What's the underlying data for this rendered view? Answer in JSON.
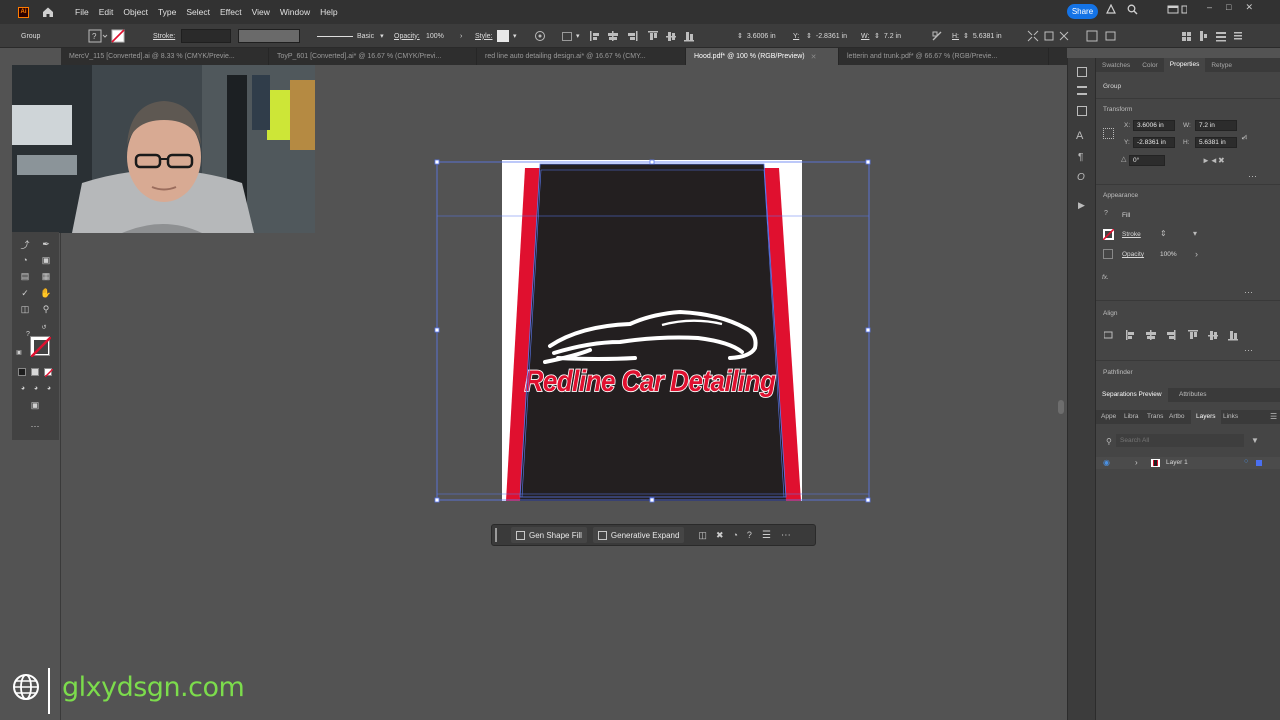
{
  "menubar": {
    "app_icon": "Ai",
    "items": [
      "File",
      "Edit",
      "Object",
      "Type",
      "Select",
      "Effect",
      "View",
      "Window",
      "Help"
    ],
    "share_label": "Share"
  },
  "controlbar": {
    "selection_type": "Group",
    "stroke_label": "Stroke:",
    "brush_label": "Basic",
    "opacity_label": "Opacity:",
    "opacity_value": "100%",
    "style_label": "Style:",
    "x_label": "X:",
    "x_value": "3.6006 in",
    "y_label": "Y:",
    "y_value": "-2.8361 in",
    "w_label": "W:",
    "w_value": "7.2 in",
    "h_label": "H:",
    "h_value": "5.6381 in"
  },
  "tabs": [
    {
      "label": "MercV_115 [Converted].ai @ 8.33 % (CMYK/Previe...",
      "active": false
    },
    {
      "label": "ToyP_601 [Converted].ai* @ 16.67 % (CMYK/Previ...",
      "active": false
    },
    {
      "label": "red line auto detailing design.ai* @ 16.67 % (CMY...",
      "active": false
    },
    {
      "label": "Hood.pdf* @ 100 % (RGB/Preview)",
      "active": true
    },
    {
      "label": "letterin and trunk.pdf* @ 66.67 % (RGB/Previe...",
      "active": false
    }
  ],
  "artwork": {
    "brand_text": "Redline Car Detailing",
    "colors": {
      "panel": "#231f20",
      "stripe": "#e0102f",
      "paper": "#ffffff",
      "selection": "#5a78f0"
    }
  },
  "context_bar": {
    "gen_shape_fill": "Gen Shape Fill",
    "generative_expand": "Generative Expand"
  },
  "right_panel": {
    "tabs": [
      "Swatches",
      "Color",
      "Properties",
      "Retype"
    ],
    "active_tab": "Properties",
    "selection_type": "Group",
    "transform_label": "Transform",
    "x_label": "X:",
    "x_value": "3.6006 in",
    "y_label": "Y:",
    "y_value": "-2.8361 in",
    "w_label": "W:",
    "w_value": "7.2 in",
    "h_label": "H:",
    "h_value": "5.6381 in",
    "angle_value": "0°",
    "appearance_label": "Appearance",
    "fill_label": "Fill",
    "stroke_label": "Stroke",
    "opacity_label": "Opacity",
    "opacity_value": "100%",
    "fx_label": "fx.",
    "align_label": "Align",
    "pathfinder_label": "Pathfinder",
    "sep_tabs": [
      "Separations Preview",
      "Attributes"
    ],
    "layer_tabs": [
      "Appe",
      "Libra",
      "Trans",
      "Artbo",
      "Layers",
      "Links"
    ],
    "active_layer_tab": "Layers",
    "search_placeholder": "Search All",
    "layer_name": "Layer 1"
  },
  "watermark": {
    "text": "glxydsgn.com"
  }
}
